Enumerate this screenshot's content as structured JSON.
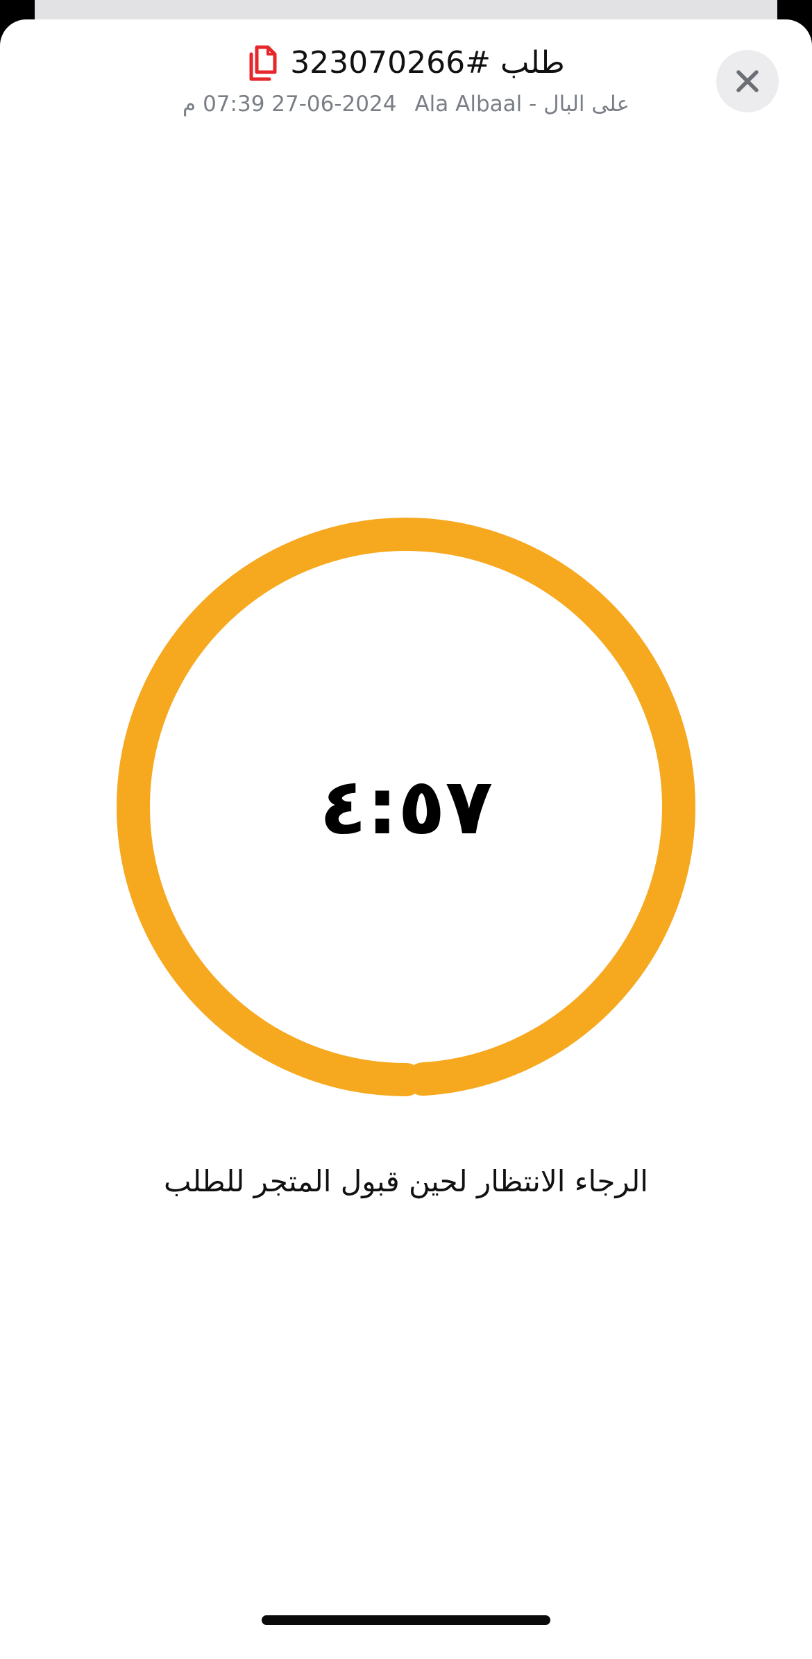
{
  "header": {
    "order_title": "طلب #323070266",
    "store_line": "على البال - Ala Albaal",
    "date_time": "27-06-2024 07:39 م"
  },
  "timer": {
    "countdown": "٤:٥٧",
    "remaining_fraction": 0.99,
    "ring_color": "#F6A81F"
  },
  "message": {
    "waiting_text": "الرجاء الانتظار لحين قبول المتجر للطلب"
  },
  "icons": {
    "copy": "copy-document-icon",
    "close": "close-icon"
  },
  "colors": {
    "accent_red": "#E5262A",
    "ring": "#F6A81F",
    "close_bg": "#ECECEE",
    "muted_text": "#7A7F87"
  }
}
